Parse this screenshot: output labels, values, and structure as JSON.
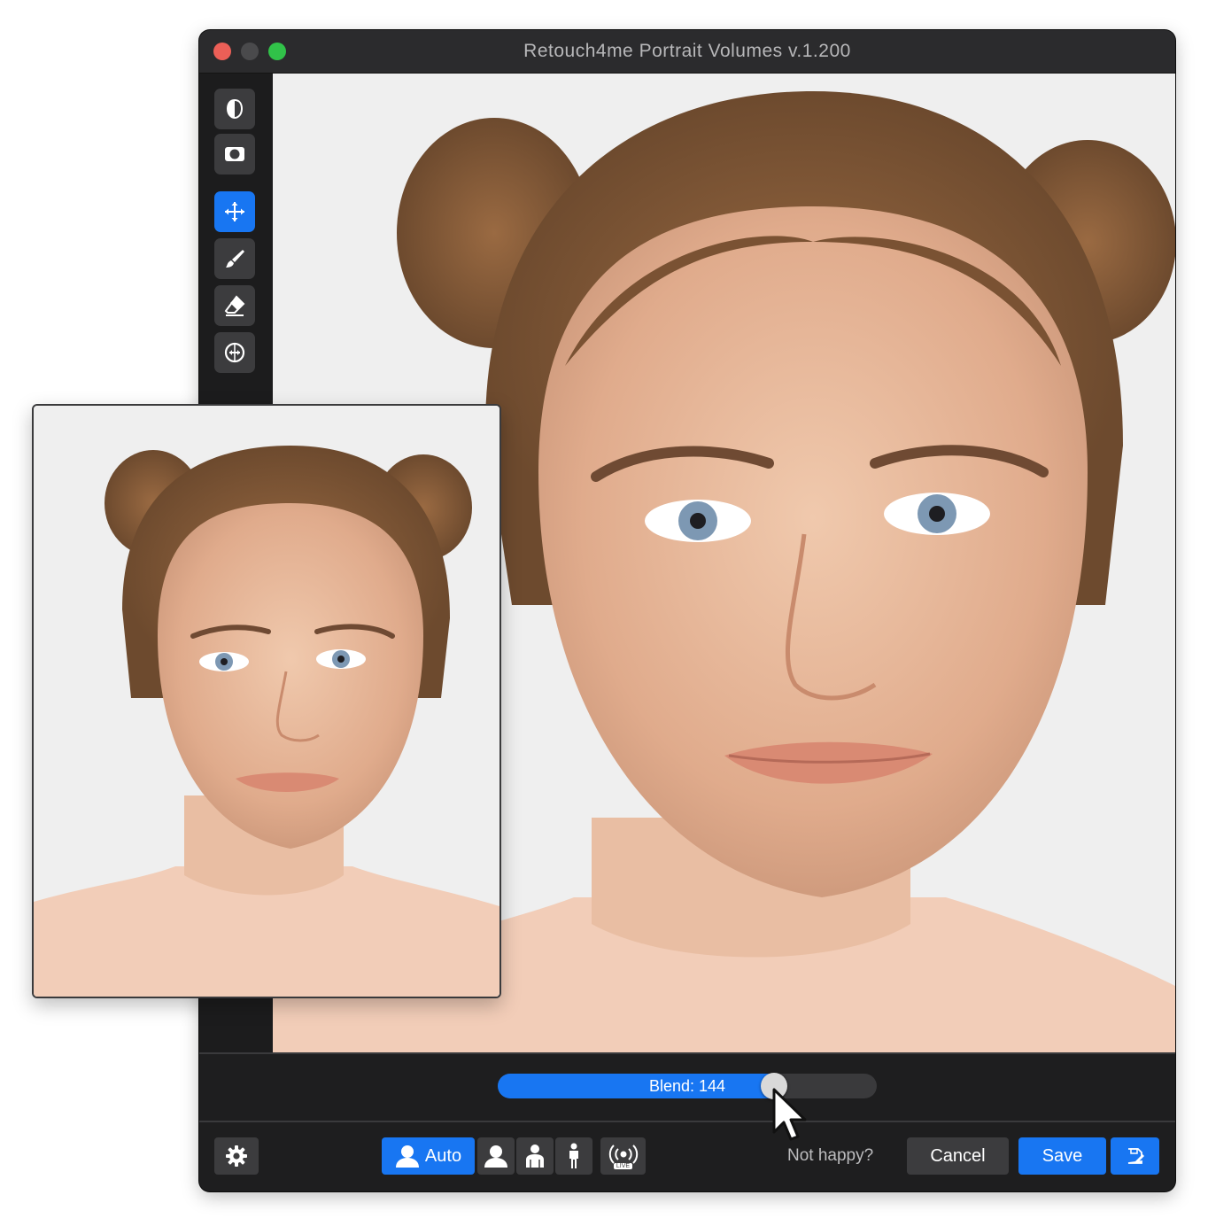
{
  "window": {
    "title": "Retouch4me Portrait Volumes v.1.200",
    "traffic_lights": [
      "close",
      "minimize",
      "zoom"
    ]
  },
  "toolbar": {
    "tools": [
      {
        "name": "face-mask-icon",
        "active": false
      },
      {
        "name": "mask-icon",
        "active": false
      },
      {
        "name": "move-icon",
        "active": true
      },
      {
        "name": "brush-icon",
        "active": false
      },
      {
        "name": "eraser-icon",
        "active": false
      },
      {
        "name": "compare-icon",
        "active": false
      }
    ],
    "active_color": "#1876f2"
  },
  "slider": {
    "label": "Blend: 144",
    "fill_fraction": 0.73
  },
  "bottom_bar": {
    "settings_icon": "gear-icon",
    "mode_auto_label": "Auto",
    "modes": [
      "portrait-head-icon",
      "portrait-half-icon",
      "portrait-full-icon",
      "live-icon"
    ],
    "live_badge": "LIVE",
    "not_happy": "Not happy?",
    "cancel_label": "Cancel",
    "save_label": "Save",
    "save_as_icon": "save-edit-icon"
  },
  "colors": {
    "accent": "#1876f2",
    "window_bg": "#1e1e1f",
    "button_dark": "#3c3c3e"
  }
}
